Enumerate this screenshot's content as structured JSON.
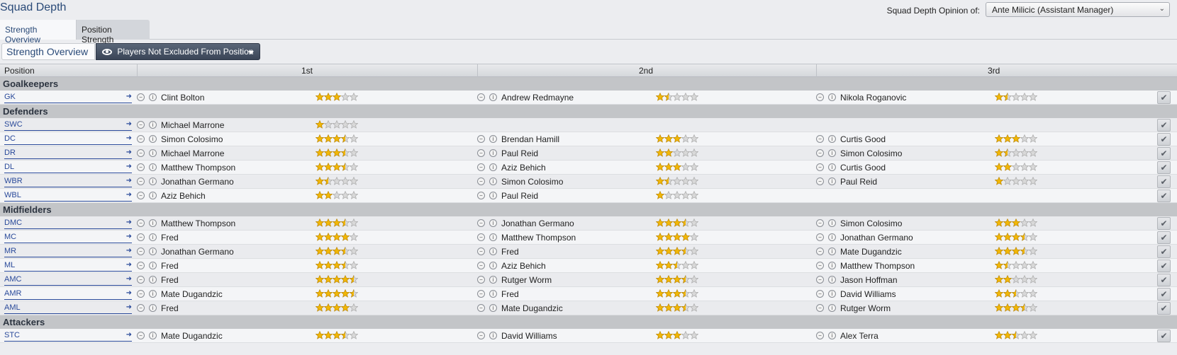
{
  "header": {
    "title": "Squad Depth",
    "opinion_label": "Squad Depth Opinion of:",
    "opinion_value": "Ante Milicic (Assistant Manager)"
  },
  "tabs": [
    {
      "label": "Strength Overview",
      "active": true
    },
    {
      "label": "Position Strength",
      "active": false
    }
  ],
  "subheader": {
    "title": "Strength Overview",
    "filter_label": "Players Not Excluded From Position"
  },
  "columns": {
    "position": "Position",
    "first": "1st",
    "second": "2nd",
    "third": "3rd"
  },
  "colors": {
    "accent": "#2a4a78",
    "link": "#2a4a9a",
    "star_fill": "#f2b705",
    "star_empty": "#d8d8d8",
    "section_bg": "#c3c5c8"
  },
  "sections": [
    {
      "name": "Goalkeepers",
      "rows": [
        {
          "pos": "GK",
          "players": [
            {
              "name": "Clint Bolton",
              "rating": 3
            },
            {
              "name": "Andrew Redmayne",
              "rating": 1.5
            },
            {
              "name": "Nikola Roganovic",
              "rating": 1.5
            }
          ]
        }
      ]
    },
    {
      "name": "Defenders",
      "rows": [
        {
          "pos": "SWC",
          "players": [
            {
              "name": "Michael Marrone",
              "rating": 1
            }
          ]
        },
        {
          "pos": "DC",
          "players": [
            {
              "name": "Simon Colosimo",
              "rating": 3.5
            },
            {
              "name": "Brendan Hamill",
              "rating": 3
            },
            {
              "name": "Curtis Good",
              "rating": 3
            }
          ]
        },
        {
          "pos": "DR",
          "players": [
            {
              "name": "Michael Marrone",
              "rating": 3.5
            },
            {
              "name": "Paul Reid",
              "rating": 2
            },
            {
              "name": "Simon Colosimo",
              "rating": 1.5
            }
          ]
        },
        {
          "pos": "DL",
          "players": [
            {
              "name": "Matthew Thompson",
              "rating": 3.5
            },
            {
              "name": "Aziz Behich",
              "rating": 3
            },
            {
              "name": "Curtis Good",
              "rating": 2
            }
          ]
        },
        {
          "pos": "WBR",
          "players": [
            {
              "name": "Jonathan Germano",
              "rating": 1.5
            },
            {
              "name": "Simon Colosimo",
              "rating": 1.5
            },
            {
              "name": "Paul Reid",
              "rating": 1
            }
          ]
        },
        {
          "pos": "WBL",
          "players": [
            {
              "name": "Aziz Behich",
              "rating": 2
            },
            {
              "name": "Paul Reid",
              "rating": 1
            }
          ]
        }
      ]
    },
    {
      "name": "Midfielders",
      "rows": [
        {
          "pos": "DMC",
          "players": [
            {
              "name": "Matthew Thompson",
              "rating": 3.5
            },
            {
              "name": "Jonathan Germano",
              "rating": 3.5
            },
            {
              "name": "Simon Colosimo",
              "rating": 3
            }
          ]
        },
        {
          "pos": "MC",
          "players": [
            {
              "name": "Fred",
              "rating": 4
            },
            {
              "name": "Matthew Thompson",
              "rating": 4
            },
            {
              "name": "Jonathan Germano",
              "rating": 3.5
            }
          ]
        },
        {
          "pos": "MR",
          "players": [
            {
              "name": "Jonathan Germano",
              "rating": 3.5
            },
            {
              "name": "Fred",
              "rating": 3.5
            },
            {
              "name": "Mate Dugandzic",
              "rating": 3.5
            }
          ]
        },
        {
          "pos": "ML",
          "players": [
            {
              "name": "Fred",
              "rating": 3.5
            },
            {
              "name": "Aziz Behich",
              "rating": 2.5
            },
            {
              "name": "Matthew Thompson",
              "rating": 1.5
            }
          ]
        },
        {
          "pos": "AMC",
          "players": [
            {
              "name": "Fred",
              "rating": 4.5
            },
            {
              "name": "Rutger Worm",
              "rating": 3.5
            },
            {
              "name": "Jason Hoffman",
              "rating": 2
            }
          ]
        },
        {
          "pos": "AMR",
          "players": [
            {
              "name": "Mate Dugandzic",
              "rating": 4.5
            },
            {
              "name": "Fred",
              "rating": 3.5
            },
            {
              "name": "David Williams",
              "rating": 2.5
            }
          ]
        },
        {
          "pos": "AML",
          "players": [
            {
              "name": "Fred",
              "rating": 4
            },
            {
              "name": "Mate Dugandzic",
              "rating": 3.5
            },
            {
              "name": "Rutger Worm",
              "rating": 3.5
            }
          ]
        }
      ]
    },
    {
      "name": "Attackers",
      "rows": [
        {
          "pos": "STC",
          "players": [
            {
              "name": "Mate Dugandzic",
              "rating": 3.5
            },
            {
              "name": "David Williams",
              "rating": 3
            },
            {
              "name": "Alex Terra",
              "rating": 2.5
            }
          ]
        }
      ]
    }
  ]
}
